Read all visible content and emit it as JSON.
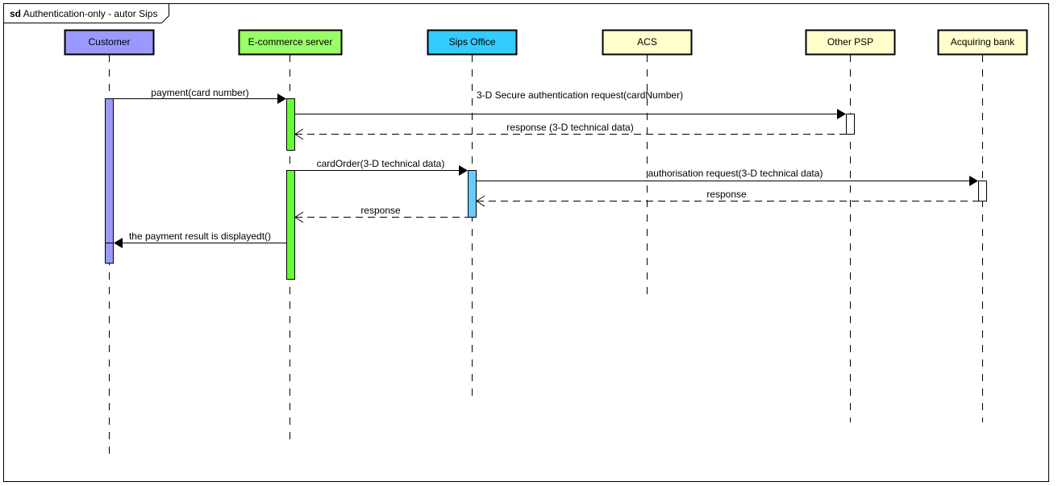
{
  "frame": {
    "keyword": "sd",
    "title": "Authentication-only - autor Sips"
  },
  "lifelines": [
    {
      "id": "customer",
      "label": "Customer",
      "color": "#9999ff"
    },
    {
      "id": "ecommerce",
      "label": "E-commerce server",
      "color": "#99ff66"
    },
    {
      "id": "sips",
      "label": "Sips Office",
      "color": "#33ccff"
    },
    {
      "id": "acs",
      "label": "ACS",
      "color": "#ffffcc"
    },
    {
      "id": "psp",
      "label": "Other PSP",
      "color": "#ffffcc"
    },
    {
      "id": "bank",
      "label": "Acquiring bank",
      "color": "#ffffcc"
    }
  ],
  "messages": [
    {
      "from": "customer",
      "to": "ecommerce",
      "label": "payment(card number)",
      "kind": "sync"
    },
    {
      "from": "ecommerce",
      "to": "psp",
      "label": "3-D Secure authentication request(cardNumber)",
      "kind": "sync"
    },
    {
      "from": "psp",
      "to": "ecommerce",
      "label": "response (3-D technical data)",
      "kind": "reply"
    },
    {
      "from": "ecommerce",
      "to": "sips",
      "label": "cardOrder(3-D technical data)",
      "kind": "sync"
    },
    {
      "from": "sips",
      "to": "bank",
      "label": "authorisation request(3-D technical data)",
      "kind": "sync"
    },
    {
      "from": "bank",
      "to": "sips",
      "label": "response",
      "kind": "reply"
    },
    {
      "from": "sips",
      "to": "ecommerce",
      "label": "response",
      "kind": "reply"
    },
    {
      "from": "ecommerce",
      "to": "customer",
      "label": "the payment result is displayedt()",
      "kind": "sync"
    }
  ],
  "colors": {
    "customer_activation": "#9999ff",
    "ecommerce_activation": "#66ff33",
    "sips_activation": "#66ccff",
    "plain_activation": "#ffffff"
  }
}
